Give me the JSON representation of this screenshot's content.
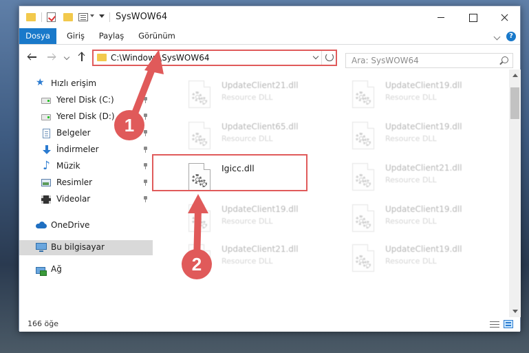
{
  "window": {
    "title": "SysWOW64"
  },
  "ribbon": {
    "tabs": [
      {
        "label": "Dosya",
        "active": true
      },
      {
        "label": "Giriş",
        "active": false
      },
      {
        "label": "Paylaş",
        "active": false
      },
      {
        "label": "Görünüm",
        "active": false
      }
    ],
    "help_label": "?"
  },
  "address": {
    "path": "C:\\Windows\\SysWOW64",
    "search_placeholder": "Ara: SysWOW64"
  },
  "sidebar": {
    "items": [
      {
        "label": "Hızlı erişim",
        "icon": "star-icon",
        "pinned": false
      },
      {
        "label": "Yerel Disk (C:)",
        "icon": "drive-icon",
        "pinned": true
      },
      {
        "label": "Yerel Disk (D:)",
        "icon": "drive-icon",
        "pinned": true
      },
      {
        "label": "Belgeler",
        "icon": "document-icon",
        "pinned": true
      },
      {
        "label": "İndirmeler",
        "icon": "download-icon",
        "pinned": true
      },
      {
        "label": "Müzik",
        "icon": "music-icon",
        "pinned": true
      },
      {
        "label": "Resimler",
        "icon": "pictures-icon",
        "pinned": true
      },
      {
        "label": "Videolar",
        "icon": "video-icon",
        "pinned": true
      },
      {
        "label": "OneDrive",
        "icon": "cloud-icon",
        "pinned": false
      },
      {
        "label": "Bu bilgisayar",
        "icon": "computer-icon",
        "pinned": false,
        "selected": true
      },
      {
        "label": "Ağ",
        "icon": "network-icon",
        "pinned": false
      }
    ]
  },
  "files": [
    {
      "name": "UpdateClient21.dll",
      "type": "Resource DLL"
    },
    {
      "name": "UpdateClient19.dll",
      "type": "Resource DLL"
    },
    {
      "name": "UpdateClient65.dll",
      "type": "Resource DLL"
    },
    {
      "name": "UpdateClient19.dll",
      "type": "Resource DLL"
    },
    {
      "name": "Igicc.dll",
      "type": ""
    },
    {
      "name": "UpdateClient21.dll",
      "type": "Resource DLL"
    },
    {
      "name": "UpdateClient19.dll",
      "type": "Resource DLL"
    },
    {
      "name": "UpdateClient19.dll",
      "type": "Resource DLL"
    },
    {
      "name": "UpdateClient21.dll",
      "type": "Resource DLL"
    },
    {
      "name": "UpdateClient19.dll",
      "type": "Resource DLL"
    }
  ],
  "status": {
    "item_count": "166 öğe"
  },
  "annotations": {
    "step1": "1",
    "step2": "2",
    "color": "#e05a5a"
  }
}
